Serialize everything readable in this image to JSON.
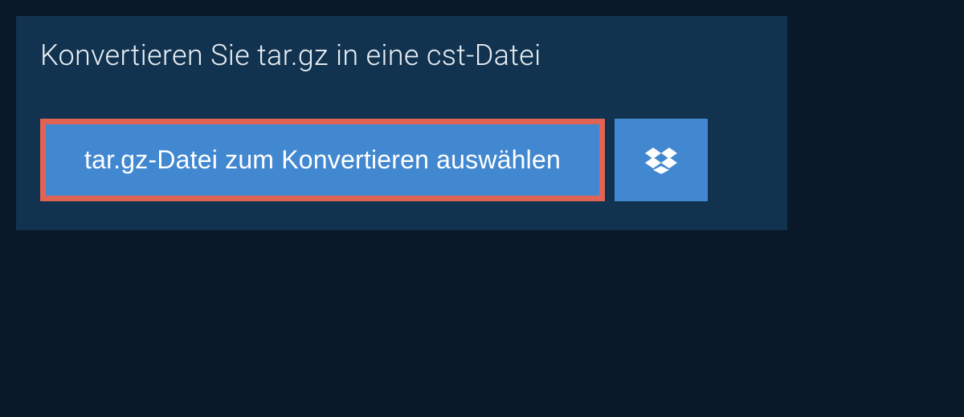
{
  "header": {
    "title": "Konvertieren Sie tar.gz in eine cst-Datei"
  },
  "actions": {
    "select_file_label": "tar.gz-Datei zum Konvertieren auswählen"
  },
  "colors": {
    "page_bg": "#0a1929",
    "panel_bg": "#11334f",
    "button_bg": "#4288d0",
    "highlight_border": "#e06354",
    "text_light": "#e8eef4"
  }
}
